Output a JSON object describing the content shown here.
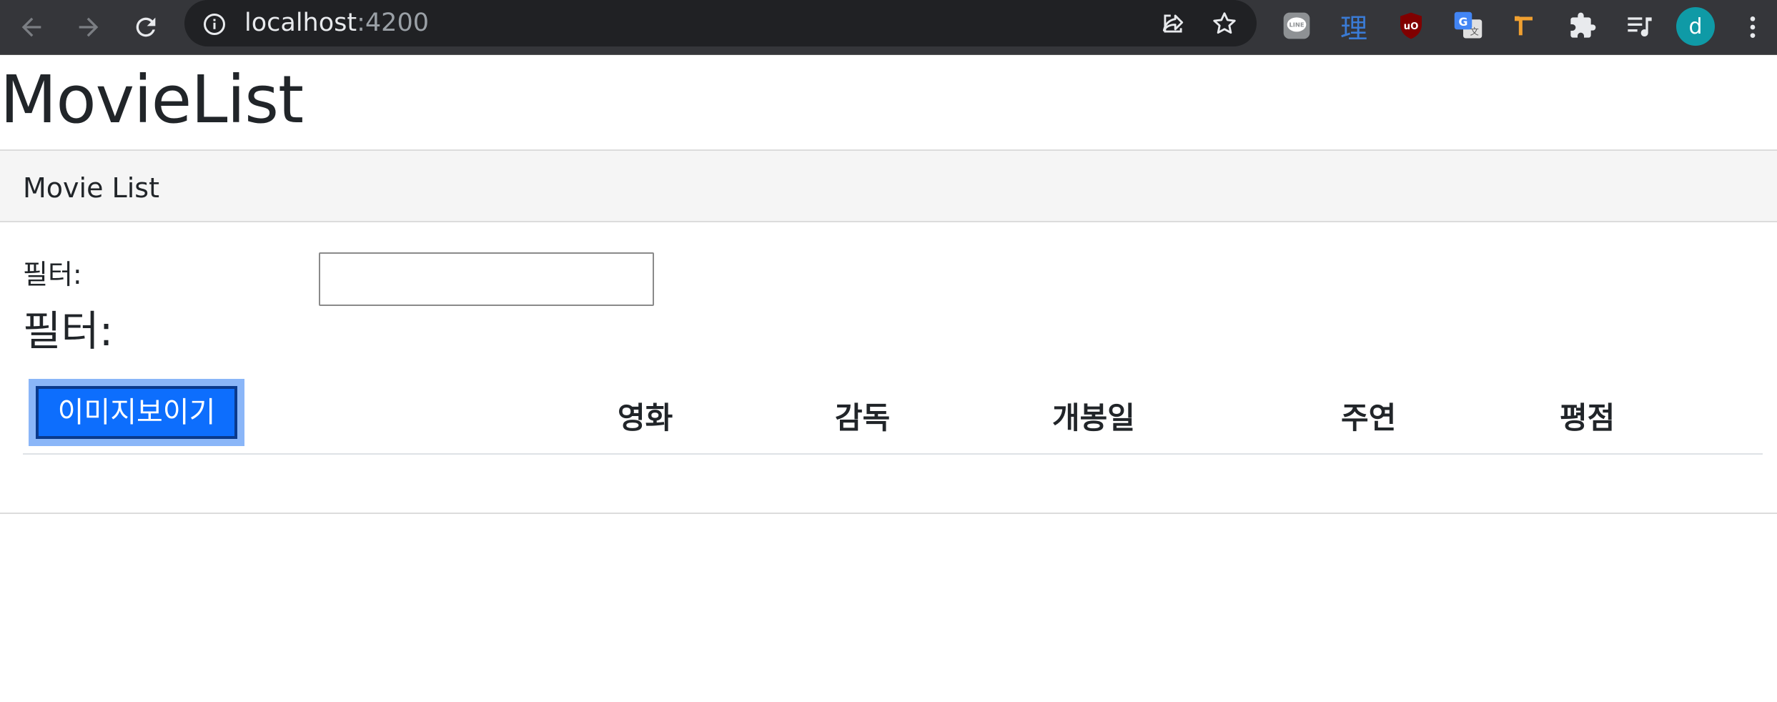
{
  "browser": {
    "url_host": "localhost",
    "url_port": ":4200",
    "profile_initial": "d",
    "colors": {
      "chrome_bg": "#35363a",
      "omnibox_bg": "#202124",
      "avatar": "#0f9aa6"
    },
    "extensions": [
      "line-icon",
      "kanji-ri-icon",
      "ublock-origin-icon",
      "google-translate-icon",
      "tampermonkey-icon",
      "extensions-puzzle-icon",
      "reading-list-icon"
    ],
    "kanji_ext_label": "理"
  },
  "page": {
    "app_title": "MovieList",
    "panel_title": "Movie List",
    "filter_label": "필터:",
    "filter_heading": "필터:",
    "filter_value": "",
    "show_image_button": "이미지보이기",
    "accent_color": "#0d6efd",
    "table_headers": [
      "영화",
      "감독",
      "개봉일",
      "주연",
      "평점"
    ],
    "rows": []
  }
}
